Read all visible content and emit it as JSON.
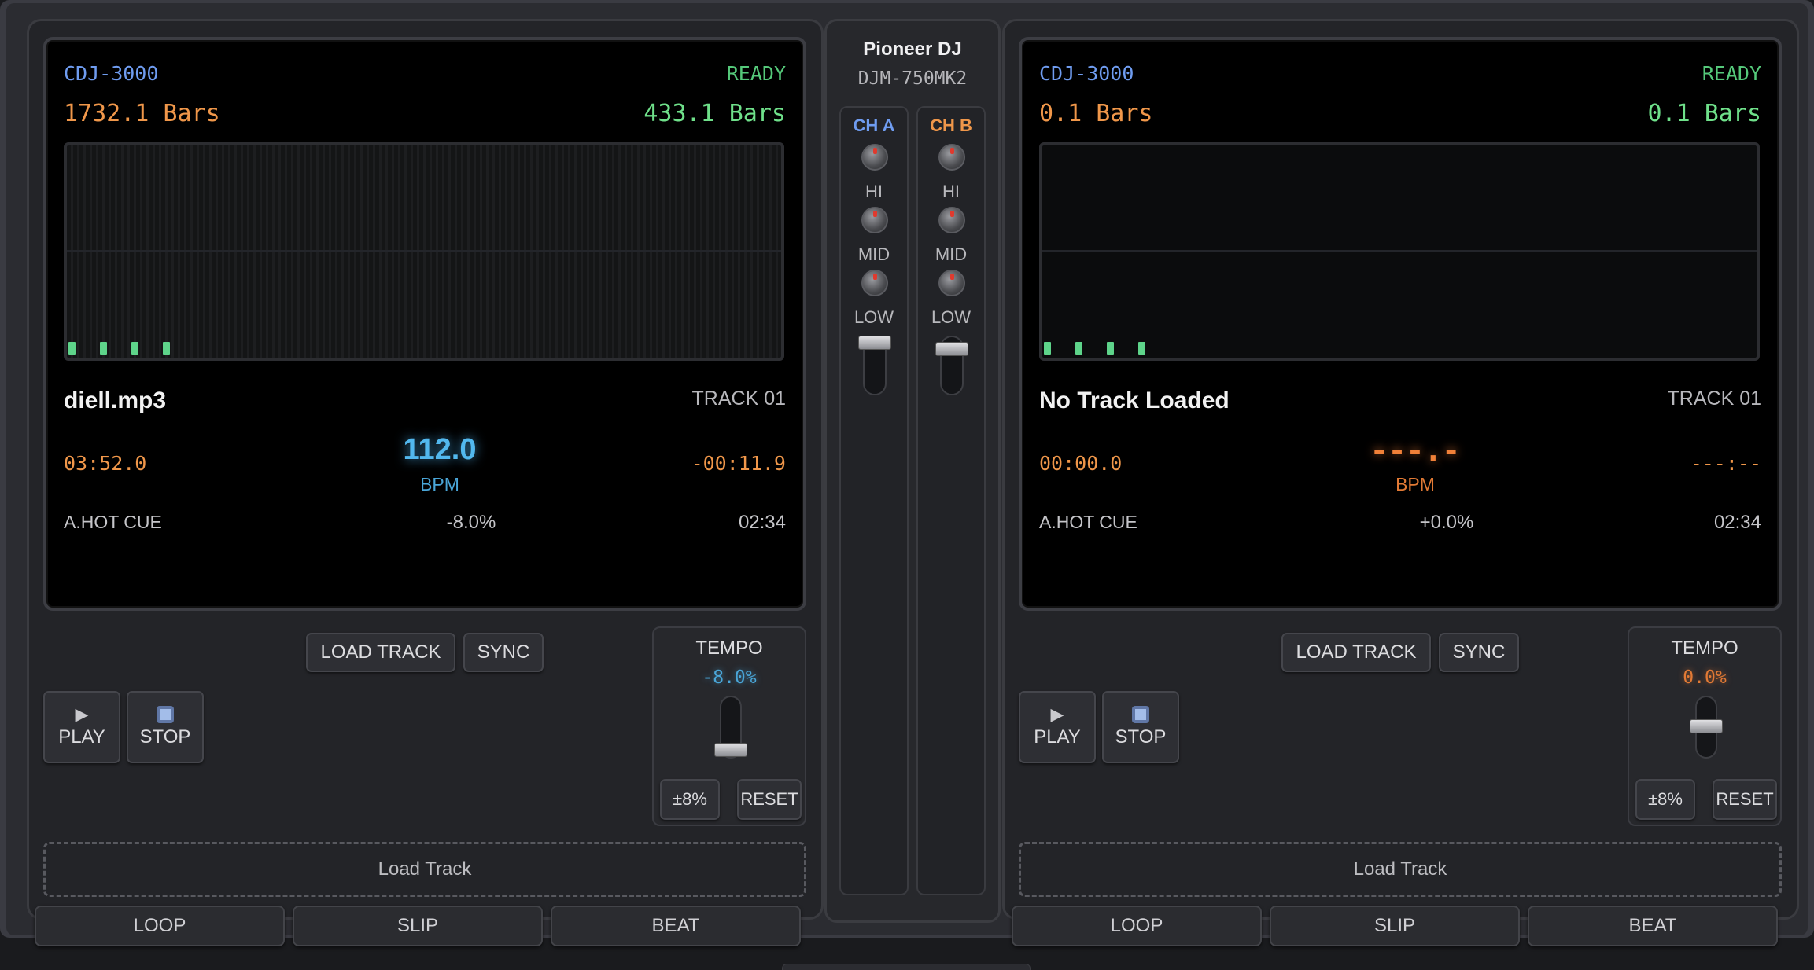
{
  "deck_a": {
    "model": "CDJ-3000",
    "status": "READY",
    "bars_elapsed": "1732.1 Bars",
    "bars_remaining": "433.1 Bars",
    "title": "diell.mp3",
    "track_no": "TRACK 01",
    "time_elapsed": "03:52.0",
    "time_remaining": "-00:11.9",
    "bpm": "112.0",
    "bpm_label": "BPM",
    "hot_cue": "A.HOT CUE",
    "pitch": "-8.0%",
    "total_time": "02:34",
    "load_track": "LOAD TRACK",
    "sync": "SYNC",
    "play": "PLAY",
    "stop": "STOP",
    "tempo_title": "TEMPO",
    "tempo_value": "-8.0%",
    "range": "±8%",
    "reset": "RESET",
    "dropzone": "Load Track",
    "loop": "LOOP",
    "slip": "SLIP",
    "beat": "BEAT",
    "tempo_fader_position": 0.92,
    "icons": {
      "play": "play-icon",
      "stop": "stop-icon"
    }
  },
  "deck_b": {
    "model": "CDJ-3000",
    "status": "READY",
    "bars_elapsed": "0.1 Bars",
    "bars_remaining": "0.1 Bars",
    "title": "No Track Loaded",
    "track_no": "TRACK 01",
    "time_elapsed": "00:00.0",
    "time_remaining": "---:--",
    "bpm": "---.-",
    "bpm_label": "BPM",
    "hot_cue": "A.HOT CUE",
    "pitch": "+0.0%",
    "total_time": "02:34",
    "load_track": "LOAD TRACK",
    "sync": "SYNC",
    "play": "PLAY",
    "stop": "STOP",
    "tempo_title": "TEMPO",
    "tempo_value": "0.0%",
    "range": "±8%",
    "reset": "RESET",
    "dropzone": "Load Track",
    "loop": "LOOP",
    "slip": "SLIP",
    "beat": "BEAT",
    "tempo_fader_position": 0.5,
    "icons": {
      "play": "play-icon",
      "stop": "stop-icon"
    }
  },
  "mixer": {
    "brand": "Pioneer DJ",
    "model": "DJM-750MK2",
    "ch_a": {
      "title": "CH A",
      "hi": "HI",
      "mid": "MID",
      "low": "LOW",
      "color": "#6f9cf0"
    },
    "ch_b": {
      "title": "CH B",
      "hi": "HI",
      "mid": "MID",
      "low": "LOW",
      "color": "#f0974a"
    }
  },
  "colors": {
    "accent_blue": "#52b8ee",
    "accent_orange": "#f08038",
    "ready_green": "#55c97a",
    "cue_green": "#5ed48a"
  }
}
